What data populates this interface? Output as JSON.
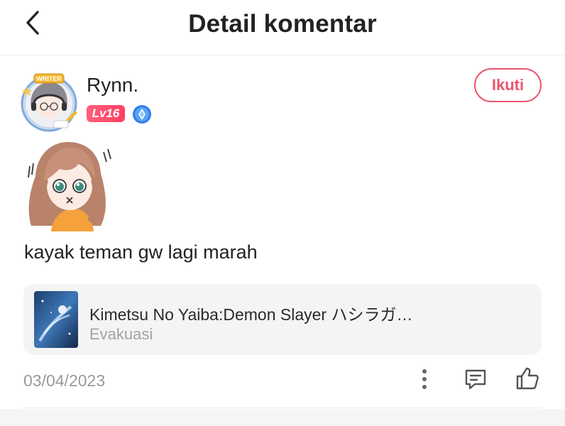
{
  "header": {
    "title": "Detail komentar",
    "back_icon": "chevron-left-icon"
  },
  "comment": {
    "user": {
      "name": "Rynn.",
      "level": "Lv16",
      "avatar_frame_label": "WRITER",
      "rank_icon": "diamond-badge-icon"
    },
    "follow_label": "Ikuti",
    "sticker": "confused-girl-sticker",
    "text": "kayak teman gw lagi marah",
    "book": {
      "title": "Kimetsu No Yaiba:Demon Slayer ハシラガ…",
      "chapter": "Evakuasi"
    },
    "date": "03/04/2023",
    "actions": {
      "more_icon": "more-vertical-icon",
      "reply_icon": "comment-icon",
      "like_icon": "thumbs-up-icon"
    }
  },
  "colors": {
    "accent": "#e8566f",
    "level_badge": "#ff4d6d",
    "rank_badge": "#2f7fe8",
    "card_bg": "#f4f4f4",
    "muted_text": "#9a9a9a"
  }
}
